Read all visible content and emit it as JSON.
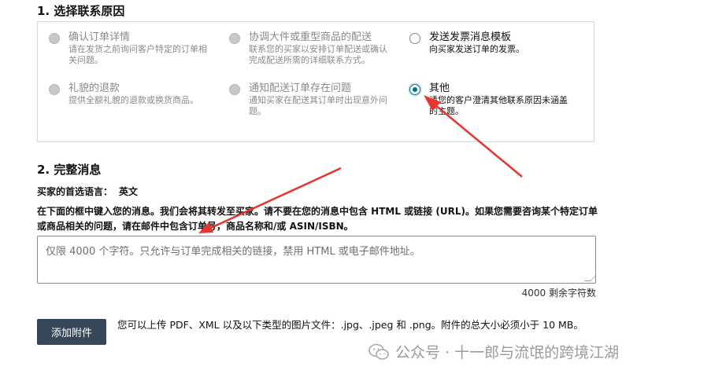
{
  "section1": {
    "title": "1. 选择联系原因"
  },
  "options": [
    {
      "label": "确认订单详情",
      "desc": "请在发货之前询问客户特定的订单相关问题。",
      "state": "disabled"
    },
    {
      "label": "协调大件或重型商品的配送",
      "desc": "联系您的买家以安排订单配送或确认完成配送所需的详细联系方式。",
      "state": "disabled"
    },
    {
      "label": "发送发票消息模板",
      "desc": "向买家发送订单的发票。",
      "state": "enabled"
    },
    {
      "label": "礼貌的退款",
      "desc": "提供全额礼貌的退款或换货商品。",
      "state": "disabled"
    },
    {
      "label": "通知配送订单存在问题",
      "desc": "通知买家在配送其订单时出现意外问题。",
      "state": "disabled"
    },
    {
      "label": "其他",
      "desc": "请您的客户澄清其他联系原因未涵盖的主题。",
      "state": "checked"
    }
  ],
  "section2": {
    "title": "2. 完整消息"
  },
  "language": {
    "label": "买家的首选语言：",
    "value": "英文"
  },
  "instructions": "在下面的框中键入您的消息。我们会将其转发至买家。请不要在您的消息中包含 HTML 或链接 (URL)。如果您需要咨询某个特定订单或商品相关的问题，请在邮件中包含订单号，商品名称和/或 ASIN/ISBN。",
  "message": {
    "placeholder": "仅限 4000 个字符。只允许与订单完成相关的链接，禁用 HTML 或电子邮件地址。",
    "value": ""
  },
  "remaining": "4000 剩余字符数",
  "attach": {
    "button": "添加附件",
    "note": "您可以上传 PDF、XML 以及以下类型的图片文件：.jpg、.jpeg 和 .png。附件的总大小必须小于 10 MB。"
  },
  "watermark": {
    "text": "公众号 · 十一郎与流氓的跨境江湖",
    "icon": "wechat-icon"
  },
  "colors": {
    "accent": "#007185",
    "button": "#37475a",
    "arrow": "#e8352b",
    "border": "#d5d9d9"
  }
}
